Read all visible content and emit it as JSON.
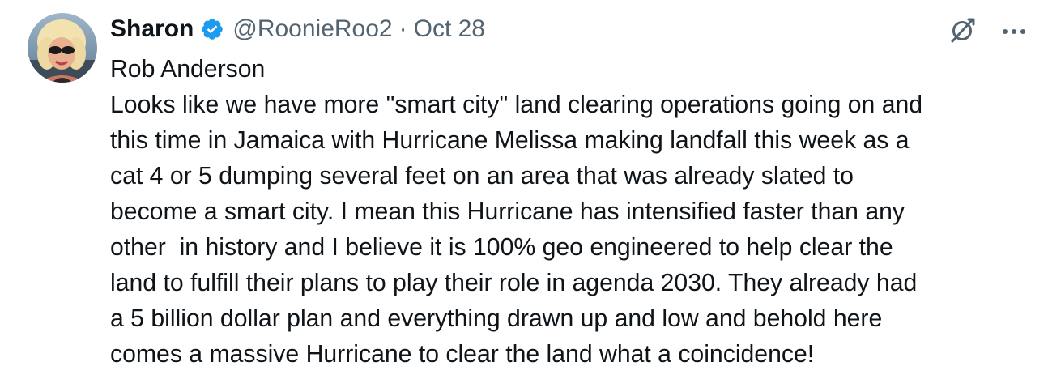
{
  "tweet": {
    "author": {
      "display_name": "Sharon",
      "handle": "@RoonieRoo2",
      "verified": true,
      "avatar_icon": "profile-photo",
      "verified_color": "#1d9bf0"
    },
    "separator": "·",
    "date": "Oct 28",
    "actions": {
      "grok_icon": "grok-icon",
      "more_icon": "more-icon"
    },
    "body_lines": [
      "Rob Anderson",
      "Looks like we have more \"smart city\" land clearing operations going on and",
      "this time in Jamaica with Hurricane Melissa making landfall this week as a",
      "cat 4 or 5 dumping several feet on an area that was already slated to",
      "become a smart city. I mean this Hurricane has intensified faster than any",
      "other  in history and I believe it is 100% geo engineered to help clear the",
      "land to fulfill their plans to play their role in agenda 2030. They already had",
      "a 5 billion dollar plan and everything drawn up and low and behold here",
      "comes a massive Hurricane to clear the land what a coincidence!"
    ]
  },
  "colors": {
    "text_primary": "#0f1419",
    "text_secondary": "#536471",
    "accent": "#1d9bf0"
  }
}
